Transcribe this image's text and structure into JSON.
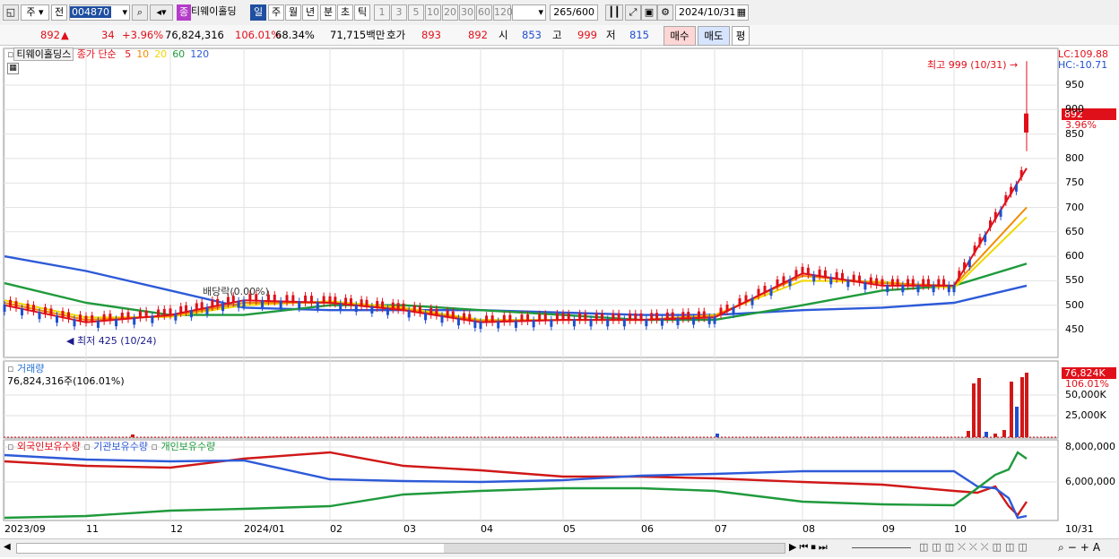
{
  "toolbar": {
    "market": "주",
    "period_prefix": "전",
    "code": "004870",
    "name_badge": "종",
    "stock_name": "티웨이홀딩",
    "periods": [
      "일",
      "주",
      "월",
      "년",
      "분",
      "초",
      "틱"
    ],
    "minutes": [
      "1",
      "3",
      "5",
      "10",
      "20",
      "30",
      "60",
      "120"
    ],
    "count": "265",
    "count_total": "/600",
    "date": "2024/10/31"
  },
  "quote": {
    "price": "892",
    "arrow": "▲",
    "change": "34",
    "change_pct": "+3.96%",
    "volume": "76,824,316",
    "volume_ratio": "106.01%",
    "turnover": "68.34%",
    "amount": "71,715백만",
    "hoga_label": "호가",
    "ask": "893",
    "bid": "892",
    "open_label": "시",
    "open": "853",
    "high_label": "고",
    "high": "999",
    "low_label": "저",
    "low": "815",
    "buy_button": "매수",
    "sell_button": "매도",
    "eval_button": "평"
  },
  "price_panel": {
    "stock_tag": "티웨이홀딩스",
    "ma_title": "종가 단순",
    "ma_periods": [
      "5",
      "10",
      "20",
      "60",
      "120"
    ],
    "ma_colors": [
      "#e0101a",
      "#f08c00",
      "#f0d800",
      "#1f9a3c",
      "#2d5ad8"
    ],
    "lc": "LC:109.88",
    "hc": "HC:-10.71",
    "high_note": "최고 999 (10/31)",
    "low_note": "최저 425 (10/24)",
    "div_note": "배당락(0.00%)",
    "price_tag": "892",
    "pct_tag": "3.96%",
    "y_ticks": [
      "950",
      "900",
      "850",
      "800",
      "750",
      "700",
      "650",
      "600",
      "550",
      "500",
      "450"
    ]
  },
  "volume_panel": {
    "title": "거래량",
    "value": "76,824,316주(106.01%)",
    "tag": "76,824K",
    "tag_pct": "106.01%",
    "y_ticks": [
      "50,000K",
      "25,000K"
    ]
  },
  "holding_panel": {
    "legend": [
      "외국인보유수량",
      "기관보유수량",
      "개인보유수량"
    ],
    "y_ticks": [
      "8,000,000",
      "6,000,000"
    ]
  },
  "x_axis": [
    "2023/09",
    "11",
    "12",
    "2024/01",
    "02",
    "03",
    "04",
    "05",
    "06",
    "07",
    "08",
    "09",
    "10",
    "10/31"
  ],
  "chart_data": {
    "type": "line",
    "title": "티웨이홀딩스",
    "ylim": [
      400,
      1000
    ],
    "x": [
      "2023/09",
      "11",
      "12",
      "2024/01",
      "02",
      "03",
      "04",
      "05",
      "06",
      "07",
      "08",
      "09",
      "10",
      "10/31"
    ],
    "series": [
      {
        "name": "5",
        "values": [
          500,
          465,
          480,
          510,
          505,
          490,
          465,
          470,
          470,
          475,
          565,
          540,
          540,
          780
        ]
      },
      {
        "name": "10",
        "values": [
          505,
          470,
          478,
          505,
          505,
          492,
          468,
          470,
          470,
          478,
          560,
          545,
          540,
          700
        ]
      },
      {
        "name": "20",
        "values": [
          510,
          475,
          476,
          500,
          508,
          495,
          470,
          470,
          470,
          480,
          550,
          548,
          535,
          680
        ]
      },
      {
        "name": "60",
        "values": [
          545,
          505,
          480,
          480,
          500,
          500,
          490,
          480,
          470,
          470,
          500,
          530,
          540,
          585
        ]
      },
      {
        "name": "120",
        "values": [
          600,
          570,
          530,
          495,
          490,
          490,
          490,
          485,
          480,
          480,
          490,
          495,
          505,
          540
        ]
      }
    ]
  }
}
